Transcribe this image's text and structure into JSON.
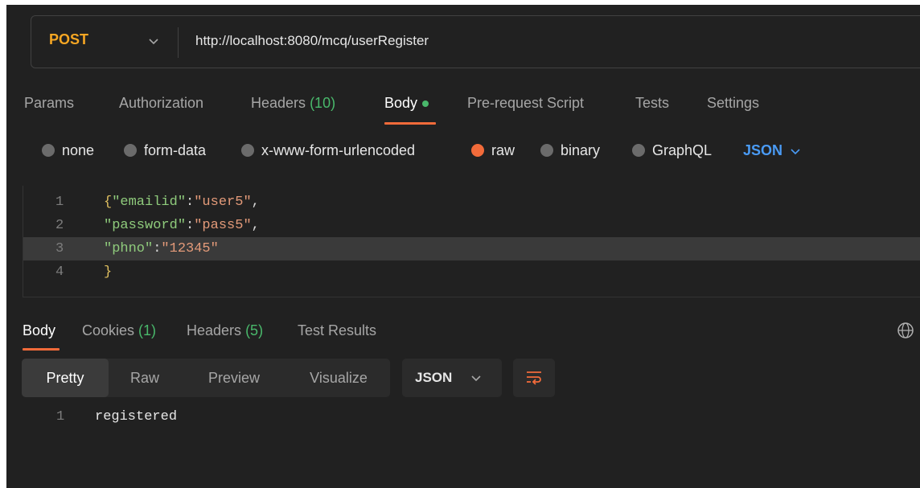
{
  "request": {
    "method": "POST",
    "url": "http://localhost:8080/mcq/userRegister"
  },
  "request_tabs": {
    "params": "Params",
    "authorization": "Authorization",
    "headers": "Headers",
    "headers_count": "(10)",
    "body": "Body",
    "pre_request": "Pre-request Script",
    "tests": "Tests",
    "settings": "Settings"
  },
  "body_types": {
    "none": "none",
    "form_data": "form-data",
    "urlencoded": "x-www-form-urlencoded",
    "raw": "raw",
    "binary": "binary",
    "graphql": "GraphQL",
    "language": "JSON",
    "selected": "raw"
  },
  "editor": {
    "lines": [
      {
        "num": "1",
        "open": "{",
        "key": "\"emailid\"",
        "sep": ":",
        "value": "\"user5\"",
        "tail": ","
      },
      {
        "num": "2",
        "key": "\"password\"",
        "sep": ":",
        "value": "\"pass5\"",
        "tail": ","
      },
      {
        "num": "3",
        "key": "\"phno\"",
        "sep": ":",
        "value": "\"12345\"",
        "tail": ""
      },
      {
        "num": "4",
        "close": "}"
      }
    ]
  },
  "response_tabs": {
    "body": "Body",
    "cookies": "Cookies",
    "cookies_count": "(1)",
    "headers": "Headers",
    "headers_count": "(5)",
    "test_results": "Test Results"
  },
  "response_view": {
    "pretty": "Pretty",
    "raw": "Raw",
    "preview": "Preview",
    "visualize": "Visualize",
    "format": "JSON"
  },
  "response_body": {
    "line_num": "1",
    "text": "registered"
  },
  "colors": {
    "background": "#212121",
    "accent": "#f26b3a",
    "method": "#f5a623",
    "json_link": "#4a9bf5",
    "count_green": "#49b86b"
  }
}
